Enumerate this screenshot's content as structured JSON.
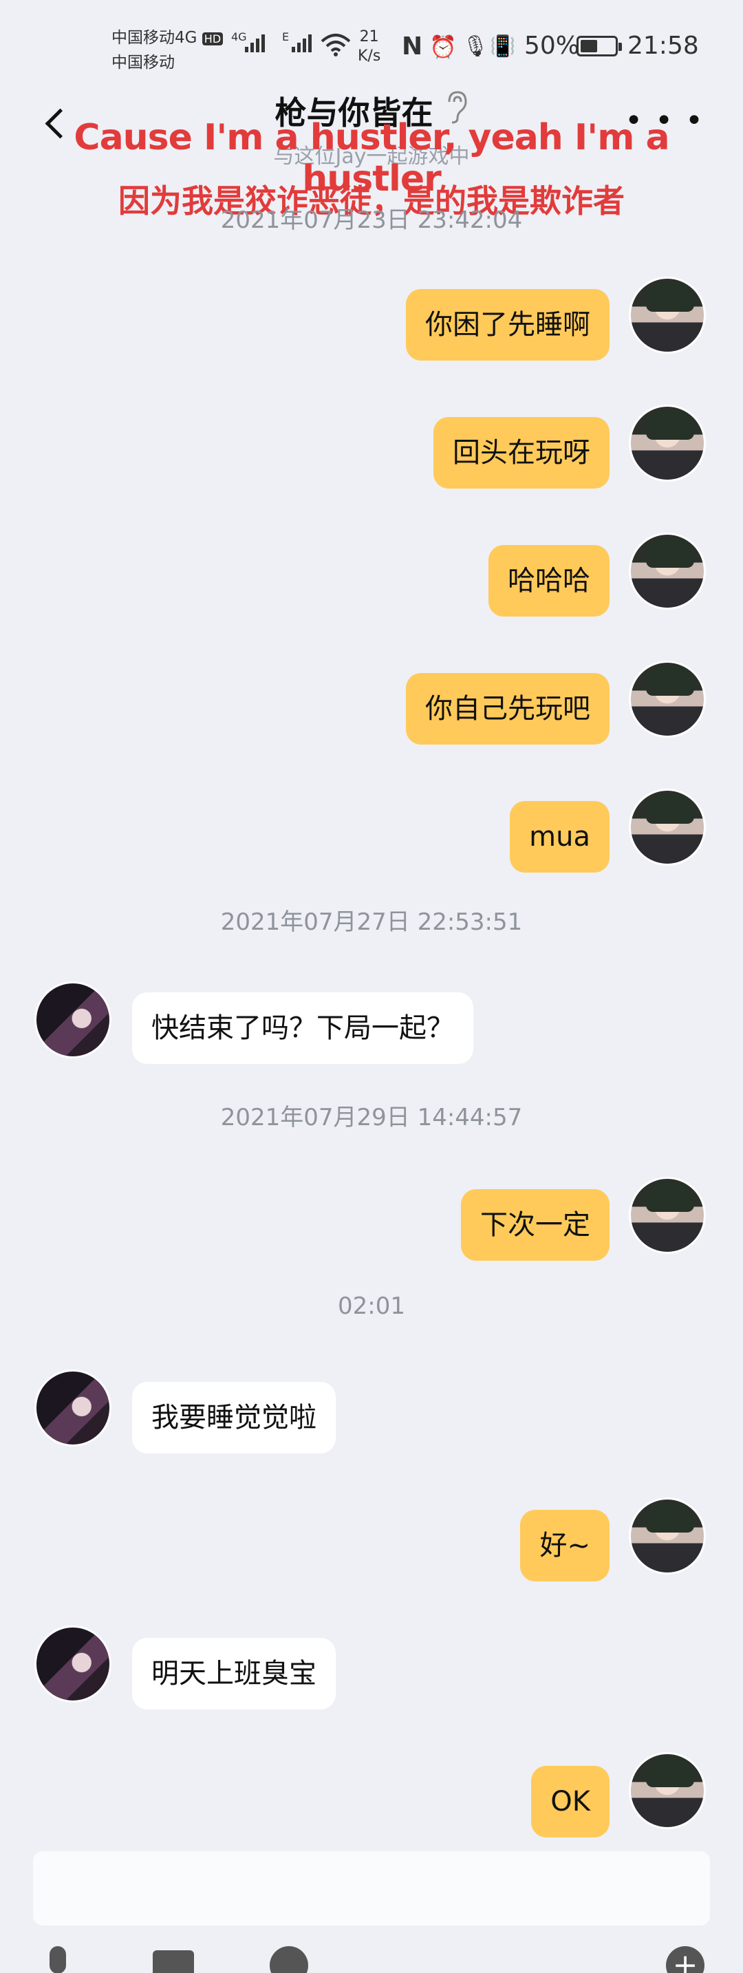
{
  "status_bar": {
    "carrier1": "中国移动4G",
    "hd_badge": "HD",
    "carrier2": "中国移动",
    "sig1_label": "4G",
    "sig2_label": "E",
    "net_speed_value": "21",
    "net_speed_unit": "K/s",
    "nfc_icon": "N",
    "alarm_icon": "⏰",
    "mic_icon": "🎙",
    "vibrate_icon": "📳",
    "battery_percent": "50%",
    "battery_level": 0.5,
    "time": "21:58"
  },
  "header": {
    "title": "枪与你皆在",
    "subtitle": "与这位Jay一起游戏中",
    "overlay_en": "Cause I'm a hustler, yeah I'm a hustler",
    "overlay_zh": "因为我是狡诈恶徒，是的我是欺诈者"
  },
  "chat": {
    "timestamps": [
      "2021年07月23日 23:42:04",
      "2021年07月27日 22:53:51",
      "2021年07月29日 14:44:57",
      "02:01"
    ],
    "messages": [
      {
        "from": "me",
        "text": "你困了先睡啊"
      },
      {
        "from": "me",
        "text": "回头在玩呀"
      },
      {
        "from": "me",
        "text": "哈哈哈"
      },
      {
        "from": "me",
        "text": "你自己先玩吧"
      },
      {
        "from": "me",
        "text": "mua"
      },
      {
        "from": "other",
        "text": "快结束了吗？下局一起？"
      },
      {
        "from": "me",
        "text": "下次一定"
      },
      {
        "from": "other",
        "text": "我要睡觉觉啦"
      },
      {
        "from": "me",
        "text": "好~"
      },
      {
        "from": "other",
        "text": "明天上班臭宝"
      },
      {
        "from": "me",
        "text": "OK"
      }
    ]
  },
  "colors": {
    "my_bubble": "#ffca5a",
    "other_bubble": "#ffffff",
    "background": "#eef0f5",
    "overlay_text": "#e23b3b"
  },
  "toolbar": {
    "icons": [
      "microphone-icon",
      "image-icon",
      "emoji-icon",
      "plus-icon"
    ]
  }
}
